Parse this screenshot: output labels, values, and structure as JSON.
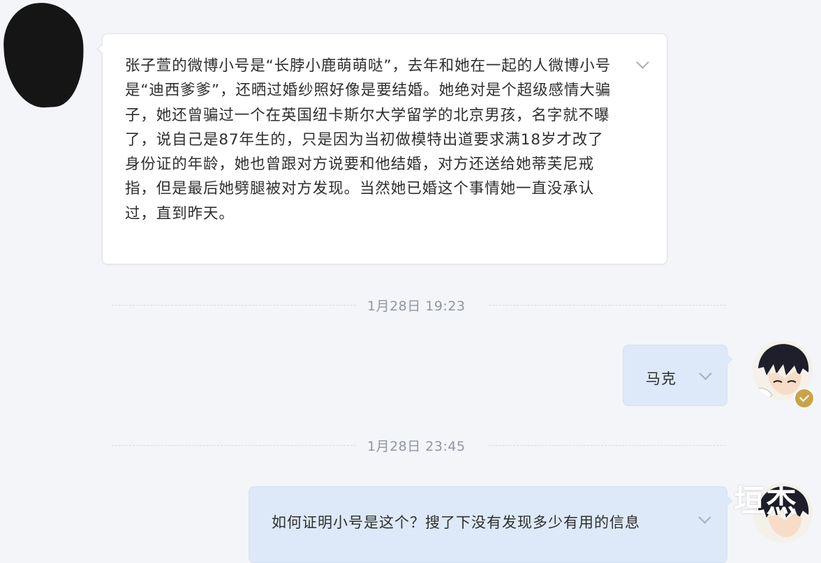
{
  "messages": {
    "incoming": {
      "text": "张子萱的微博小号是“长脖小鹿萌萌哒”，去年和她在一起的人微博小号是“迪西爹爹”，还晒过婚纱照好像是要结婚。她绝对是个超级感情大骗子，她还曾骗过一个在英国纽卡斯尔大学留学的北京男孩，名字就不曝了，说自己是87年生的，只是因为当初做模特出道要求满18岁才改了身份证的年龄，她也曾跟对方说要和他结婚，对方还送给她蒂芙尼戒指，但是最后她劈腿被对方发现。当然她已婚这个事情她一直没承认过，直到昨天。"
    },
    "timestamp_1": "1月28日 19:23",
    "outgoing_1": {
      "text": "马克"
    },
    "timestamp_2": "1月28日 23:45",
    "outgoing_2": {
      "text": "如何证明小号是这个？搜了下没有发现多少有用的信息"
    }
  },
  "watermark": "垣杰",
  "icons": {
    "expand": "chevron-down-icon",
    "verified": "verified-badge-icon"
  },
  "colors": {
    "background": "#f4f5f8",
    "incoming_bubble": "#ffffff",
    "outgoing_bubble": "#dde9f8",
    "timestamp": "#8f96a1",
    "badge": "#c9a34a"
  }
}
